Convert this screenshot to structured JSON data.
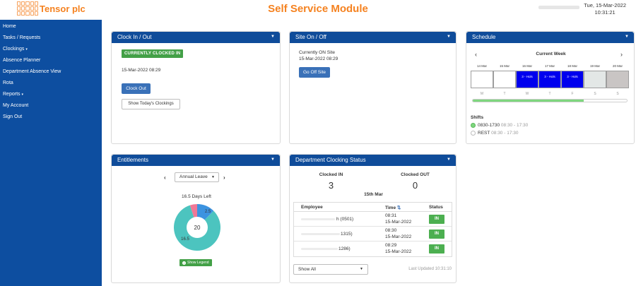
{
  "header": {
    "logo_text": "Tensor plc",
    "module_title": "Self Service Module",
    "date": "Tue, 15-Mar-2022",
    "time": "10:31:21"
  },
  "sidebar": {
    "items": [
      {
        "label": "Home"
      },
      {
        "label": "Tasks / Requests"
      },
      {
        "label": "Clockings",
        "has_caret": true
      },
      {
        "label": "Absence Planner"
      },
      {
        "label": "Department Absence View"
      },
      {
        "label": "Rota"
      },
      {
        "label": "Reports",
        "has_caret": true
      },
      {
        "label": "My Account"
      },
      {
        "label": "Sign Out"
      }
    ],
    "caret": "▾"
  },
  "clock_panel": {
    "title": "Clock In / Out",
    "status": "CURRENTLY CLOCKED IN",
    "timestamp": "15-Mar-2022 08:29",
    "clock_out_label": "Clock Out",
    "todays_clockings_label": "Show Today's Clockings"
  },
  "site_panel": {
    "title": "Site On / Off",
    "status_text": "Currently ON Site",
    "timestamp": "15-Mar-2022 08:29",
    "go_off_label": "Go Off Site"
  },
  "schedule_panel": {
    "title": "Schedule",
    "week_label": "Current Week",
    "days": [
      {
        "date": "14 Mar",
        "letter": "M",
        "event": "",
        "color": "#ffffff"
      },
      {
        "date": "15 Mar",
        "letter": "T",
        "event": "",
        "color": "#ffffff"
      },
      {
        "date": "16 Mar",
        "letter": "W",
        "event": "3 - Hols",
        "color": "#0000ee"
      },
      {
        "date": "17 Mar",
        "letter": "T",
        "event": "3 - Hols",
        "color": "#0000ee"
      },
      {
        "date": "18 Mar",
        "letter": "F",
        "event": "3 - Hols",
        "color": "#0000ee"
      },
      {
        "date": "19 Mar",
        "letter": "S",
        "event": "",
        "color": "#e3e7e6"
      },
      {
        "date": "20 Mar",
        "letter": "S",
        "event": "",
        "color": "#c9c5c4"
      }
    ],
    "progress_fraction": 0.72,
    "shifts_label": "Shifts",
    "shifts": [
      {
        "code": "0830-1730",
        "time": "08:30 - 17:30",
        "active": true
      },
      {
        "code": "REST",
        "time": "08:30 - 17:30",
        "active": false
      }
    ]
  },
  "entitlements_panel": {
    "title": "Entitlements",
    "leave_type": "Annual Leave",
    "days_left": "16.5 Days Left",
    "total_label": "20",
    "slices": [
      {
        "label": "16.5",
        "value": 16.5,
        "color": "#4cc4bf"
      },
      {
        "label": "2.5",
        "value": 2.5,
        "color": "#3c93e0"
      },
      {
        "label": "",
        "value": 1,
        "color": "#f07897"
      }
    ],
    "show_legend_label": "Show Legend"
  },
  "dept_panel": {
    "title": "Department Clocking Status",
    "clocked_in_label": "Clocked IN",
    "clocked_in_count": "3",
    "clocked_out_label": "Clocked OUT",
    "clocked_out_count": "0",
    "date_label": "15th Mar",
    "columns": {
      "employee": "Employee",
      "time": "Time",
      "status": "Status"
    },
    "sort_icon": "⇅",
    "rows": [
      {
        "employee": "h (0501)",
        "time": "08:31",
        "date": "15-Mar-2022",
        "status": "IN"
      },
      {
        "employee": "1315)",
        "time": "08:30",
        "date": "15-Mar-2022",
        "status": "IN"
      },
      {
        "employee": "1286)",
        "time": "08:29",
        "date": "15-Mar-2022",
        "status": "IN"
      }
    ],
    "filter_value": "Show All",
    "last_updated": "Last Updated 10:31:10"
  }
}
